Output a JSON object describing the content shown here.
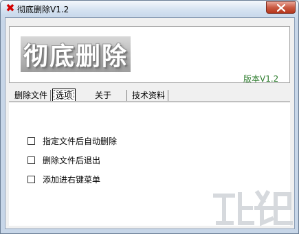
{
  "window": {
    "title": "彻底删除V1.2"
  },
  "banner": {
    "logo_text": "彻底删除",
    "version": "版本V1.2"
  },
  "tabs": [
    {
      "label": "删除文件"
    },
    {
      "label": "选项"
    },
    {
      "label": "关于"
    },
    {
      "label": "技术资料"
    }
  ],
  "options": [
    {
      "label": "指定文件后自动删除",
      "checked": false
    },
    {
      "label": "删除文件后退出",
      "checked": false
    },
    {
      "label": "添加进右键菜单",
      "checked": false
    }
  ],
  "colors": {
    "version_text": "#2e7d2e",
    "close_button": "#c95a42"
  }
}
